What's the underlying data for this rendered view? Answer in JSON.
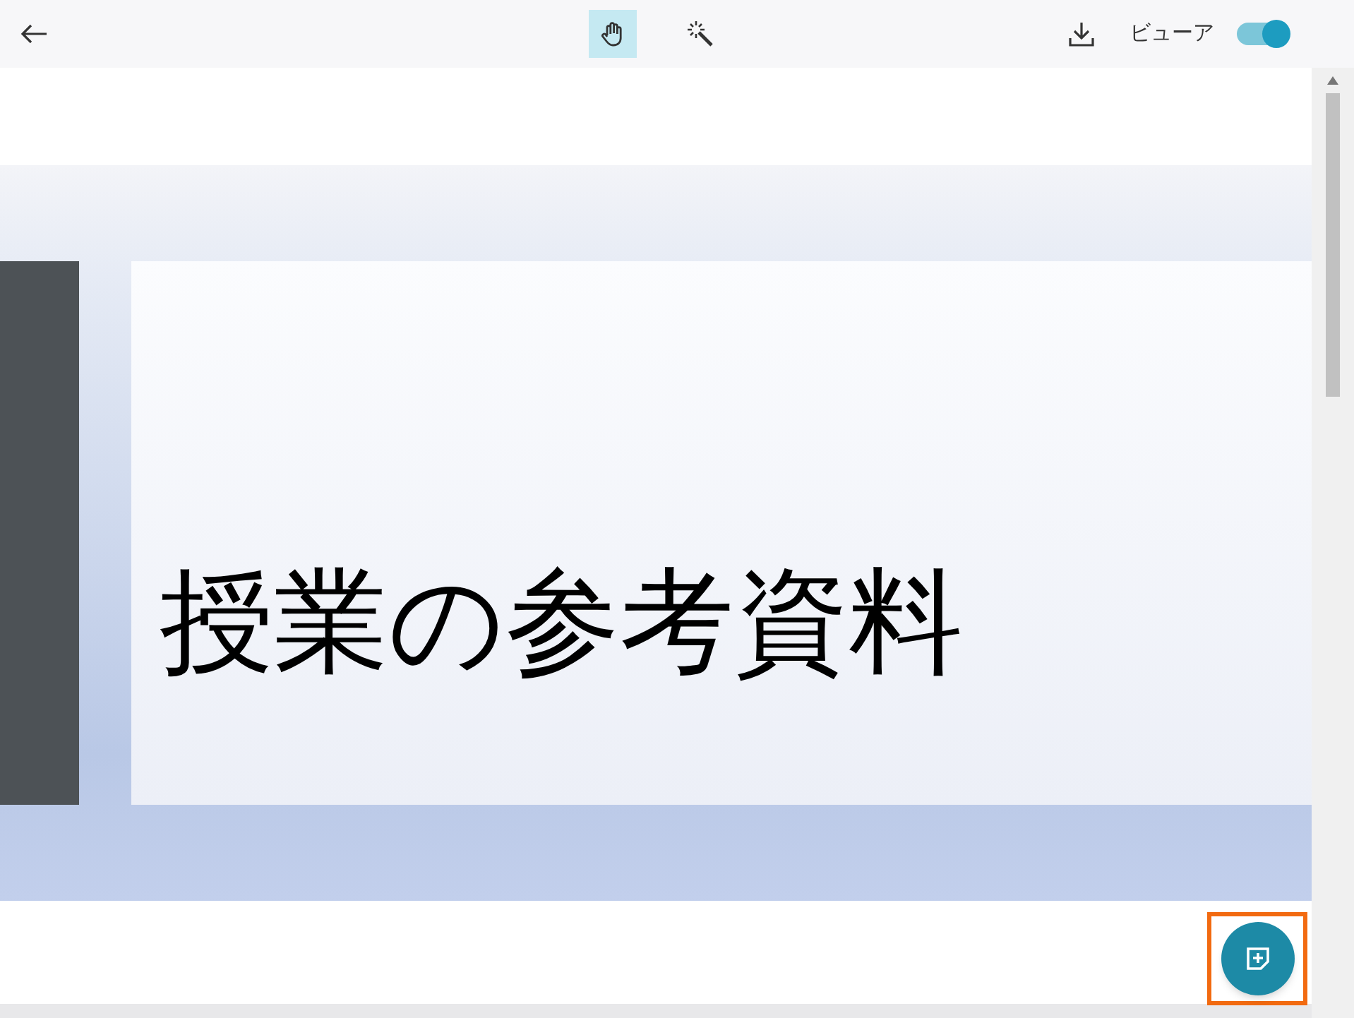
{
  "toolbar": {
    "tools": [
      {
        "kind": "hand",
        "selected": true
      },
      {
        "kind": "wand",
        "selected": false
      }
    ],
    "viewer_label": "ビューア",
    "viewer_on": true
  },
  "slide": {
    "title": "授業の参考資料"
  },
  "fab": {
    "highlighted": true
  }
}
